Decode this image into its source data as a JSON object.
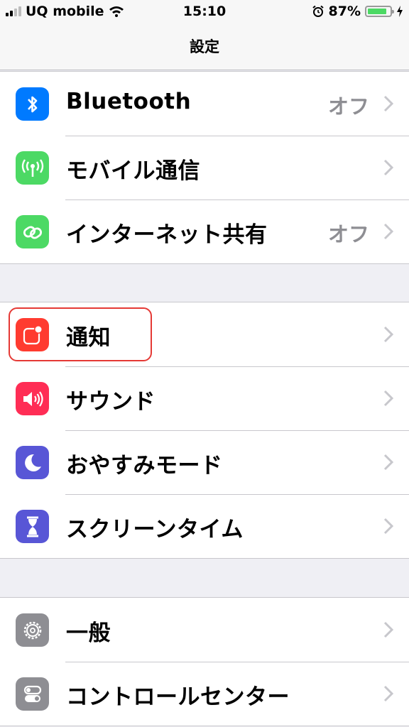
{
  "status_bar": {
    "carrier": "UQ mobile",
    "time": "15:10",
    "battery": "87%",
    "battery_level": 0.87,
    "icons": [
      "signal-icon",
      "wifi-icon",
      "alarm-icon",
      "battery-icon",
      "charging-icon"
    ]
  },
  "nav": {
    "title": "設定"
  },
  "groups": [
    {
      "items": [
        {
          "label": "Bluetooth",
          "value": "オフ",
          "icon": "bluetooth-icon",
          "color": "#007aff"
        },
        {
          "label": "モバイル通信",
          "value": "",
          "icon": "antenna-icon",
          "color": "#4cd964"
        },
        {
          "label": "インターネット共有",
          "value": "オフ",
          "icon": "link-icon",
          "color": "#4cd964"
        }
      ]
    },
    {
      "items": [
        {
          "label": "通知",
          "value": "",
          "icon": "notifications-icon",
          "color": "#ff3b30"
        },
        {
          "label": "サウンド",
          "value": "",
          "icon": "speaker-icon",
          "color": "#ff2d55"
        },
        {
          "label": "おやすみモード",
          "value": "",
          "icon": "moon-icon",
          "color": "#5856d6"
        },
        {
          "label": "スクリーンタイム",
          "value": "",
          "icon": "hourglass-icon",
          "color": "#5856d6"
        }
      ]
    },
    {
      "items": [
        {
          "label": "一般",
          "value": "",
          "icon": "gear-icon",
          "color": "#8e8e93"
        },
        {
          "label": "コントロールセンター",
          "value": "",
          "icon": "toggles-icon",
          "color": "#8e8e93"
        }
      ]
    }
  ],
  "highlight_color": "#e53935"
}
